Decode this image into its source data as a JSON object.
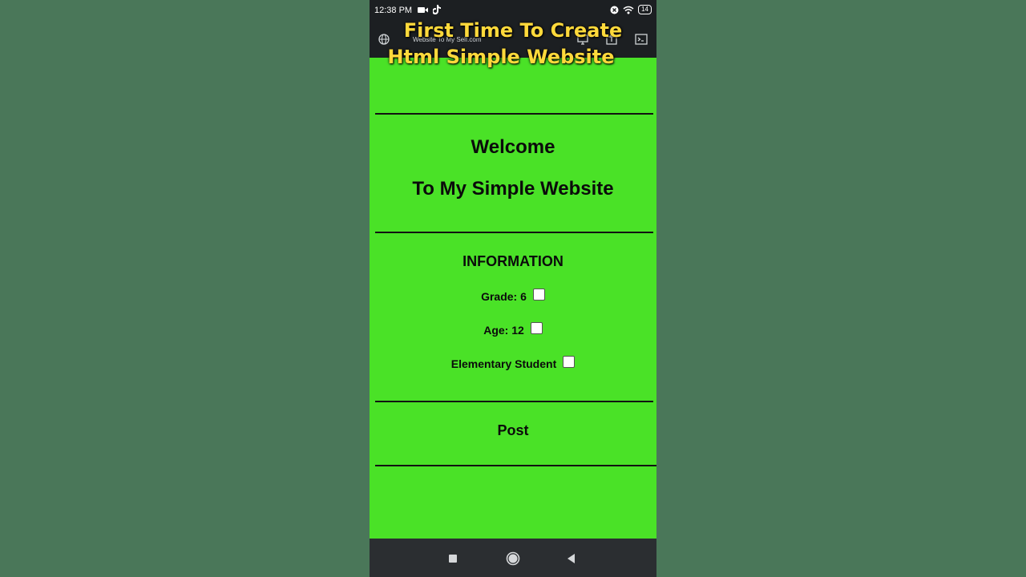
{
  "status_bar": {
    "time": "12:38 PM",
    "battery": "14",
    "icons_left": [
      "video-camera-icon",
      "tiktok-icon"
    ],
    "icons_right": [
      "close-circle-icon",
      "wifi-icon",
      "battery-icon"
    ]
  },
  "toolbar": {
    "url": "Website To My Self.com",
    "icons": [
      "globe-icon",
      "desktop-icon",
      "share-icon",
      "terminal-icon"
    ]
  },
  "overlay": {
    "line1": "First Time To Create",
    "line2": "Html Simple Website",
    "color": "#ffd93b"
  },
  "page": {
    "background": "#4ae227",
    "welcome": "Welcome",
    "subtitle": "To My Simple Website",
    "info_heading": "INFORMATION",
    "info_items": [
      {
        "label": "Grade: 6",
        "checked": false
      },
      {
        "label": "Age: 12",
        "checked": false
      },
      {
        "label": "Elementary Student",
        "checked": false
      }
    ],
    "post": "Post"
  },
  "nav_bar": {
    "buttons": [
      "recent-apps-icon",
      "home-icon",
      "back-icon"
    ]
  }
}
